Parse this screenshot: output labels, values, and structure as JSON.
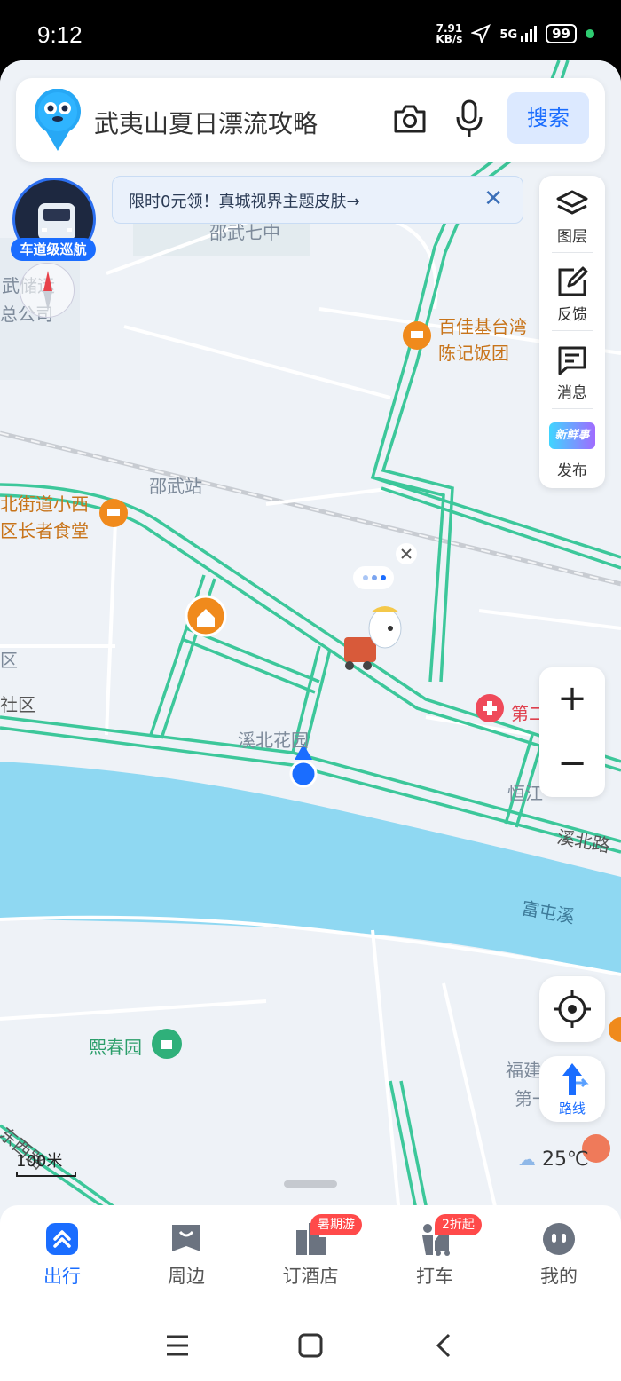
{
  "status_bar": {
    "time": "9:12",
    "net_speed": "7.91",
    "net_unit": "KB/s",
    "signal": "5G",
    "battery": "99"
  },
  "search": {
    "query": "武夷山夏日漂流攻略",
    "button": "搜索",
    "camera_icon": "camera-icon",
    "mic_icon": "microphone-icon"
  },
  "promo": {
    "text": "限时0元领！真城视界主题皮肤→"
  },
  "car_badge": {
    "label": "车道级巡航"
  },
  "tools": [
    {
      "label": "图层",
      "icon": "layers-icon"
    },
    {
      "label": "反馈",
      "icon": "feedback-icon"
    },
    {
      "label": "消息",
      "icon": "message-icon"
    },
    {
      "label": "发布",
      "icon": "publish-icon",
      "badge": "新鲜事"
    }
  ],
  "zoom": {
    "in": "+",
    "out": "−"
  },
  "route_button": "路线",
  "map_labels": {
    "school": "邵武七中",
    "wuchu_1": "武储运",
    "wuchu_2": "总公司",
    "poi_restaurant_1": "百佳基台湾",
    "poi_restaurant_2": "陈记饭团",
    "station": "邵武站",
    "canteen_1": "北街道小西",
    "canteen_2": "区长者食堂",
    "district_1": "区",
    "district_2": "社区",
    "garden": "溪北花园",
    "hospital": "第二",
    "hengjiang": "恒江",
    "road_xibei": "溪北路",
    "river": "富屯溪",
    "xichun": "熙春园",
    "fujian_1": "福建",
    "fujian_2": "第一",
    "road_sw": "东西路"
  },
  "scale": "100米",
  "weather": "25℃",
  "tabs": [
    {
      "label": "出行",
      "icon": "travel-icon",
      "active": true
    },
    {
      "label": "周边",
      "icon": "nearby-icon"
    },
    {
      "label": "订酒店",
      "icon": "hotel-icon",
      "tag": "暑期游"
    },
    {
      "label": "打车",
      "icon": "taxi-icon",
      "tag": "2折起"
    },
    {
      "label": "我的",
      "icon": "profile-icon"
    }
  ],
  "colors": {
    "accent": "#1a6dff",
    "road": "#3cc79a",
    "river": "#8fd8f2",
    "poi_orange": "#f08a1c"
  }
}
